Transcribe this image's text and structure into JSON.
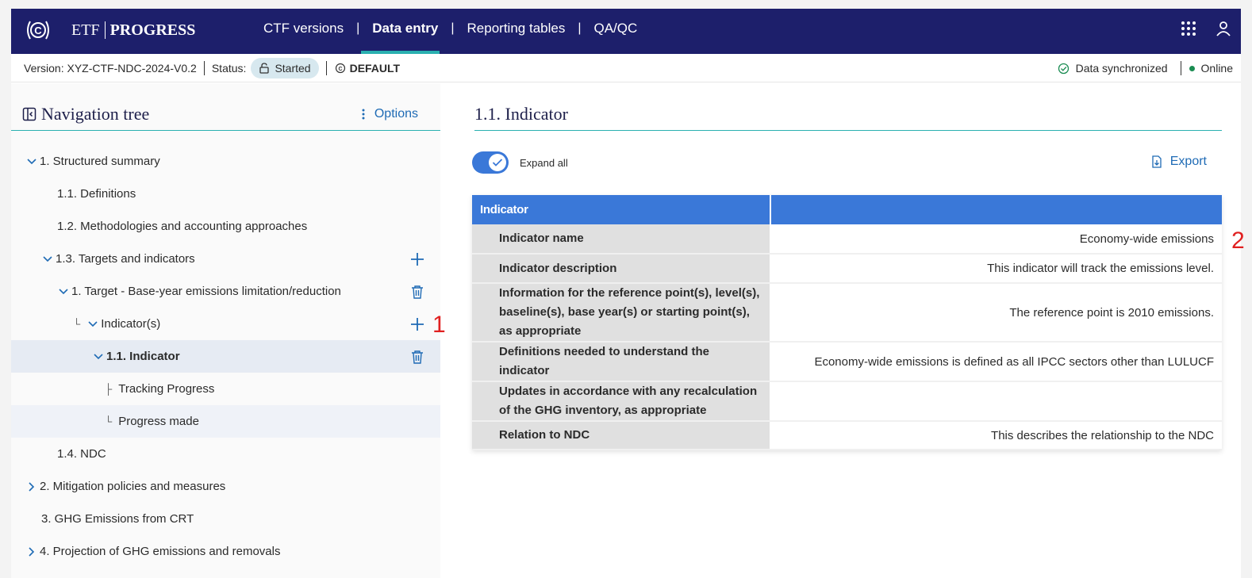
{
  "app": {
    "brand_part1": "ETF",
    "brand_part2": "PROGRESS",
    "tabs": [
      {
        "label": "CTF versions",
        "active": false
      },
      {
        "label": "Data entry",
        "active": true
      },
      {
        "label": "Reporting tables",
        "active": false
      },
      {
        "label": "QA/QC",
        "active": false
      }
    ],
    "separator": "|",
    "icons": [
      "apps-grid-icon",
      "user-icon"
    ],
    "colors": {
      "topbar": "#1d1f6b",
      "accent": "#2ab0b0",
      "primary": "#3a78d8",
      "link": "#1f6bb5"
    }
  },
  "status": {
    "version": "Version: XYZ-CTF-NDC-2024-V0.2",
    "status_label": "Status:",
    "status_value": "Started",
    "default_label": "DEFAULT",
    "sync": "Data synchronized",
    "online": "Online"
  },
  "sidebar": {
    "title": "Navigation tree",
    "options": "Options",
    "items": [
      {
        "label": "1. Structured summary",
        "chevron": "down",
        "action": ""
      },
      {
        "label": "1.1. Definitions",
        "chevron": "",
        "action": ""
      },
      {
        "label": "1.2. Methodologies and accounting approaches",
        "chevron": "",
        "action": ""
      },
      {
        "label": "1.3. Targets and indicators",
        "chevron": "down",
        "action": "add"
      },
      {
        "label": "1. Target - Base-year emissions limitation/reduction",
        "chevron": "down",
        "action": "delete"
      },
      {
        "label": "Indicator(s)",
        "chevron": "down",
        "action": "add",
        "connector": "└"
      },
      {
        "label": "1.1. Indicator",
        "chevron": "down",
        "action": "delete",
        "selected": true
      },
      {
        "label": "Tracking Progress",
        "chevron": "",
        "action": "",
        "connector": "├"
      },
      {
        "label": "Progress made",
        "chevron": "",
        "action": "",
        "connector": "└",
        "hover": true
      },
      {
        "label": "1.4. NDC",
        "chevron": "",
        "action": ""
      },
      {
        "label": "2. Mitigation policies and measures",
        "chevron": "right",
        "action": ""
      },
      {
        "label": "3. GHG Emissions from CRT",
        "chevron": "",
        "action": ""
      },
      {
        "label": "4. Projection of GHG emissions and removals",
        "chevron": "right",
        "action": ""
      }
    ]
  },
  "main": {
    "title": "1.1. Indicator",
    "expand_all": "Expand all",
    "expand_all_on": true,
    "export": "Export",
    "table": {
      "header": [
        "Indicator",
        ""
      ],
      "rows": [
        {
          "label": "Indicator name",
          "value": "Economy-wide emissions"
        },
        {
          "label": "Indicator description",
          "value": "This indicator will track the emissions level."
        },
        {
          "label": "Information for the reference point(s), level(s), baseline(s), base year(s) or starting point(s), as appropriate",
          "value": "The reference point is 2010 emissions."
        },
        {
          "label": "Definitions needed to understand the indicator",
          "value": "Economy-wide emissions is defined as all IPCC sectors other than LULUCF"
        },
        {
          "label": "Updates in accordance with any recalculation of the GHG inventory, as appropriate",
          "value": ""
        },
        {
          "label": "Relation to NDC",
          "value": "This describes the relationship to the NDC"
        }
      ]
    }
  },
  "annotations": {
    "a1": "1",
    "a2": "2"
  }
}
